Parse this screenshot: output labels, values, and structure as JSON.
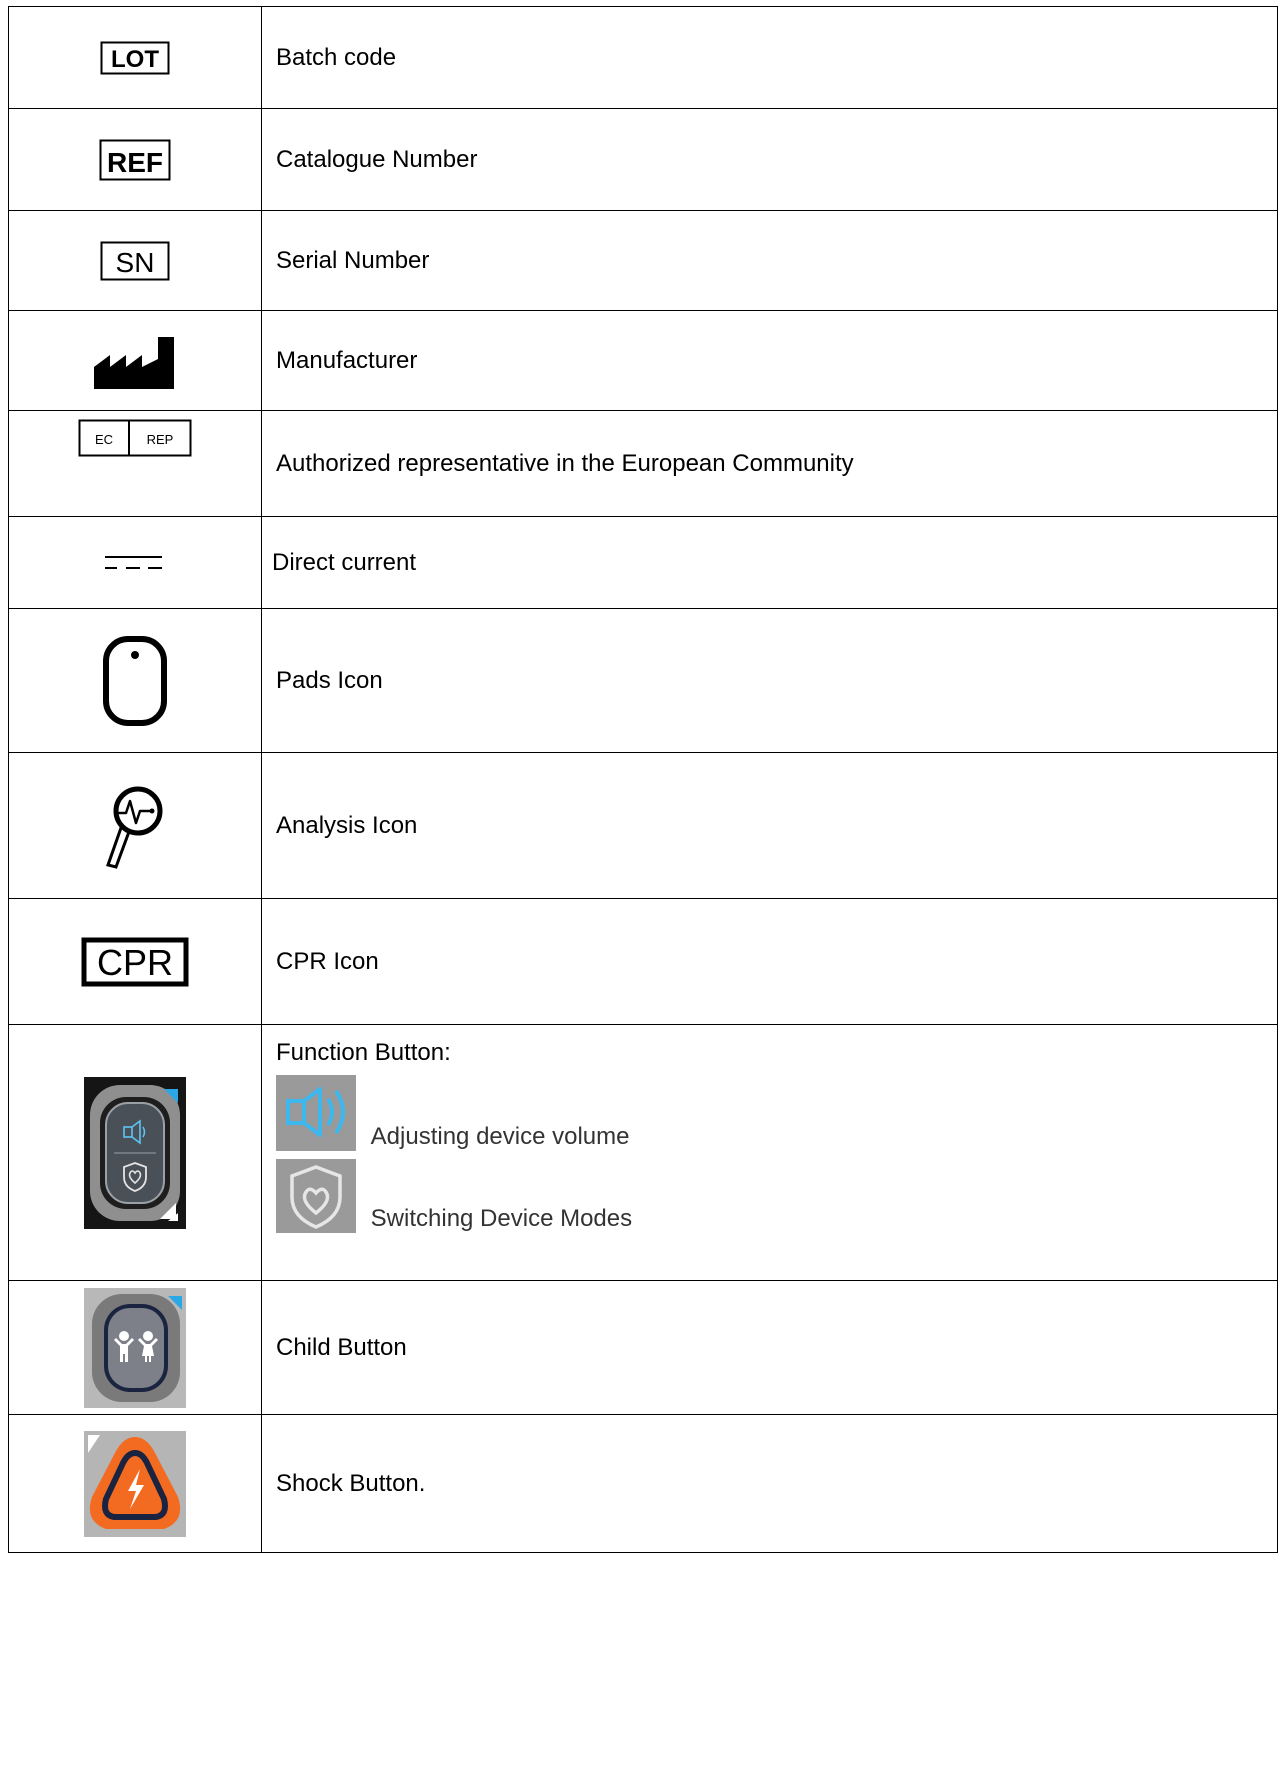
{
  "rows": [
    {
      "icon": "lot-batch-code-icon",
      "symbol_text": "LOT",
      "label": "Batch code"
    },
    {
      "icon": "ref-catalogue-number-icon",
      "symbol_text": "REF",
      "label": "Catalogue Number"
    },
    {
      "icon": "sn-serial-number-icon",
      "symbol_text": "SN",
      "label": "Serial Number"
    },
    {
      "icon": "factory-manufacturer-icon",
      "label": "Manufacturer"
    },
    {
      "icon": "ec-rep-icon",
      "symbol_text": [
        "EC",
        "REP"
      ],
      "label": "Authorized representative in the European Community"
    },
    {
      "icon": "direct-current-icon",
      "label": "Direct current"
    },
    {
      "icon": "pads-icon",
      "label": "Pads Icon"
    },
    {
      "icon": "analysis-magnifier-icon",
      "label": "Analysis Icon"
    },
    {
      "icon": "cpr-icon",
      "symbol_text": "CPR",
      "label": "CPR Icon"
    },
    {
      "icon": "function-button-icon",
      "label": "Function Button:",
      "sub_items": [
        {
          "icon": "speaker-volume-icon",
          "label": "Adjusting device volume"
        },
        {
          "icon": "shield-heart-icon",
          "label": "Switching Device Modes"
        }
      ]
    },
    {
      "icon": "child-button-icon",
      "label": "Child Button"
    },
    {
      "icon": "shock-button-icon",
      "label": "Shock Button."
    }
  ],
  "colors": {
    "border": "#000000",
    "blue_accent": "#2aa8e6",
    "shock_orange": "#f26b21",
    "button_dark_navy": "#1a2340",
    "sub_text": "#333333"
  }
}
